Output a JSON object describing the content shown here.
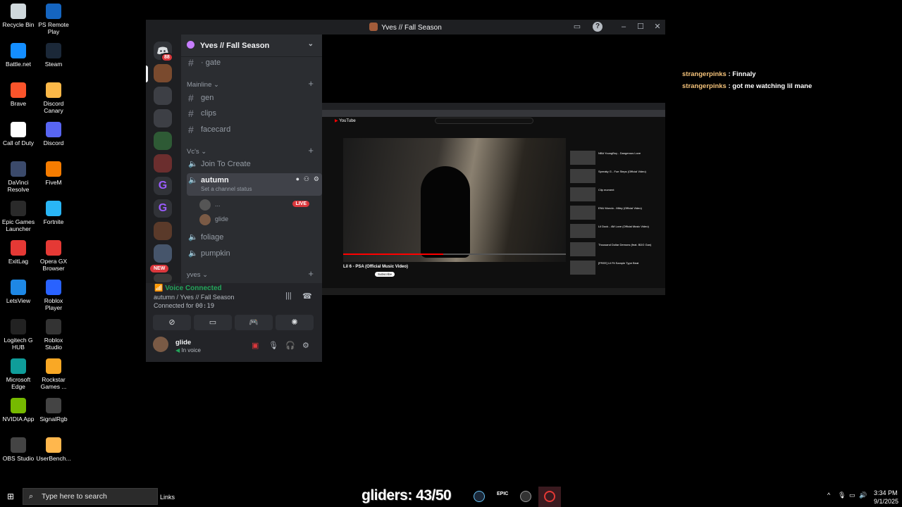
{
  "desktop": {
    "icons_col1": [
      {
        "label": "Recycle Bin",
        "icon": "recycle-bin-icon",
        "color": "#cfd8dc"
      },
      {
        "label": "Battle.net",
        "icon": "battle-net-icon",
        "color": "#148eff"
      },
      {
        "label": "Brave",
        "icon": "brave-icon",
        "color": "#fb542b"
      },
      {
        "label": "Call of Duty",
        "icon": "document-icon",
        "color": "#ffffff"
      },
      {
        "label": "DaVinci Resolve",
        "icon": "davinci-icon",
        "color": "#3b4a6b"
      },
      {
        "label": "Epic Games Launcher",
        "icon": "epic-games-icon",
        "color": "#2a2a2a"
      },
      {
        "label": "ExitLag",
        "icon": "exitlag-icon",
        "color": "#e53935"
      },
      {
        "label": "LetsView",
        "icon": "letsview-icon",
        "color": "#1e88e5"
      },
      {
        "label": "Logitech G HUB",
        "icon": "logitech-icon",
        "color": "#222222"
      },
      {
        "label": "Microsoft Edge",
        "icon": "edge-icon",
        "color": "#0f9d9a"
      },
      {
        "label": "NVIDIA App",
        "icon": "nvidia-icon",
        "color": "#76b900"
      },
      {
        "label": "OBS Studio",
        "icon": "obs-icon",
        "color": "#444444"
      }
    ],
    "icons_col2": [
      {
        "label": "PS Remote Play",
        "icon": "ps-remote-icon",
        "color": "#1565c0"
      },
      {
        "label": "Steam",
        "icon": "steam-icon",
        "color": "#1b2838"
      },
      {
        "label": "Discord Canary",
        "icon": "discord-canary-icon",
        "color": "#fbb848"
      },
      {
        "label": "Discord",
        "icon": "discord-icon",
        "color": "#5865f2"
      },
      {
        "label": "FiveM",
        "icon": "fivem-icon",
        "color": "#f57c00"
      },
      {
        "label": "Fortnite",
        "icon": "fortnite-icon",
        "color": "#29b6f6"
      },
      {
        "label": "Opera GX Browser",
        "icon": "opera-gx-icon",
        "color": "#e53935"
      },
      {
        "label": "Roblox Player",
        "icon": "roblox-icon",
        "color": "#2962ff"
      },
      {
        "label": "Roblox Studio",
        "icon": "roblox-studio-icon",
        "color": "#333333"
      },
      {
        "label": "Rockstar Games ...",
        "icon": "rockstar-icon",
        "color": "#f9a825"
      },
      {
        "label": "SignalRgb",
        "icon": "signalrgb-icon",
        "color": "#444444"
      },
      {
        "label": "UserBench...",
        "icon": "userbench-icon",
        "color": "#ffb74d"
      }
    ]
  },
  "discord": {
    "window_title": "Yves // Fall Season",
    "guild_badge": "88",
    "new_badge": "NEW",
    "server_name": "Yves // Fall Season",
    "top_channel": "· gate",
    "categories": {
      "mainline": "Mainline",
      "vcs": "Vc's",
      "yves": "yves"
    },
    "text_channels": [
      "gen",
      "clips",
      "facecard"
    ],
    "voice_channels": {
      "join": "Join To Create",
      "active": "autumn",
      "status_placeholder": "Set a channel status",
      "others": [
        "foliage",
        "pumpkin"
      ]
    },
    "voice_users": [
      {
        "name": "...",
        "live": "LIVE"
      },
      {
        "name": "glide"
      }
    ],
    "voice_panel": {
      "status": "Voice Connected",
      "location": "autumn / Yves // Fall Season",
      "connected_label": "Connected for",
      "connected_time": "00:19"
    },
    "user": {
      "name": "glide",
      "status": "In voice"
    }
  },
  "stream": {
    "video_title": "Lil 6 - PSA (Official Music Video)",
    "site": "YouTube",
    "subscribe": "Subscribe",
    "recommended": [
      "NBA YoungBoy - Dangerous Love",
      "Spreaky G - Foe Steps (Official Video)",
      "Clip moment",
      "ENU Mondo - Miley (Official Video)",
      "Lil Dock - 4M Love (Official Music Video)",
      "Thousand Dollar Demons (feat. BDG Gan)",
      "[FREE] Lil Fit Sample Type Beat"
    ]
  },
  "chat": [
    {
      "user": "strangerpinks",
      "text": ": Finnaly"
    },
    {
      "user": "strangerpinks",
      "text": ": got me watching lil mane"
    }
  ],
  "taskbar": {
    "search_placeholder": "Type here to search",
    "links": "Links",
    "overlay": "gliders: 43/50",
    "time": "3:34 PM",
    "date": "9/1/2025"
  },
  "colors": {
    "discord_bg": "#2b2d31",
    "voice_green": "#23a55a",
    "live_red": "#da373c",
    "chat_user": "#f6c47b"
  }
}
